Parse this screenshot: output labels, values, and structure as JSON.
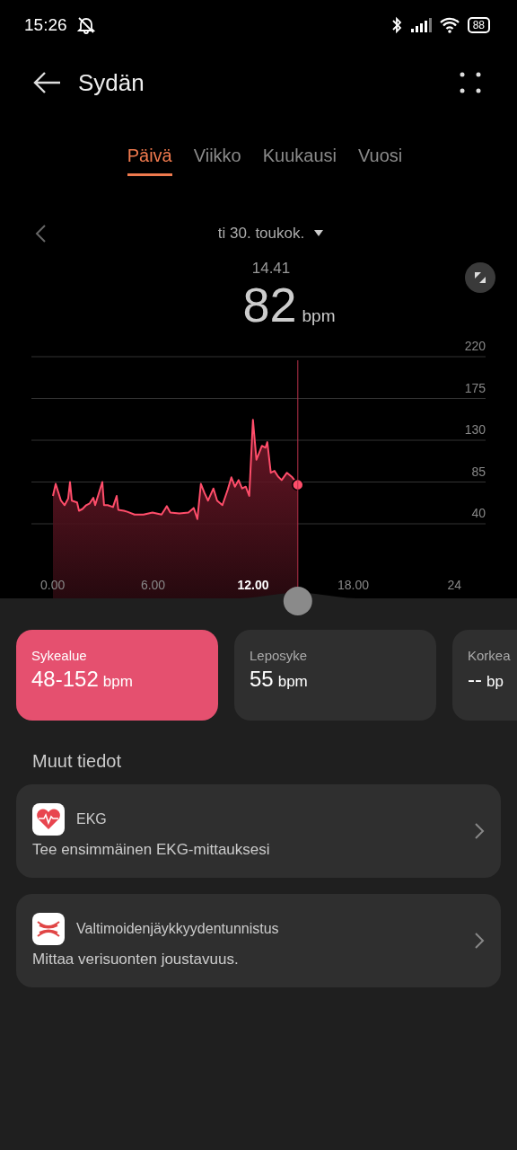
{
  "status_bar": {
    "time": "15:26",
    "battery": "88"
  },
  "header": {
    "title": "Sydän"
  },
  "tabs": [
    {
      "label": "Päivä",
      "selected": true
    },
    {
      "label": "Viikko",
      "selected": false
    },
    {
      "label": "Kuukausi",
      "selected": false
    },
    {
      "label": "Vuosi",
      "selected": false
    }
  ],
  "date_nav": {
    "date": "ti 30. toukok."
  },
  "reading": {
    "time": "14.41",
    "value": "82",
    "unit": "bpm"
  },
  "chart_data": {
    "type": "area",
    "x": [
      0,
      0.16,
      0.48,
      0.7,
      0.91,
      1.02,
      1.13,
      1.45,
      1.56,
      1.77,
      1.99,
      2.2,
      2.42,
      2.53,
      2.96,
      3.06,
      3.28,
      3.6,
      3.82,
      3.92,
      4.25,
      4.46,
      4.89,
      5.43,
      5.97,
      6.51,
      6.83,
      7.04,
      7.58,
      8.12,
      8.44,
      8.66,
      8.87,
      9.09,
      9.3,
      9.62,
      9.84,
      10.16,
      10.48,
      10.7,
      10.91,
      11.13,
      11.34,
      11.56,
      11.77,
      11.99,
      12.2,
      12.42,
      12.53,
      12.74,
      12.85,
      13.06,
      13.28,
      13.49,
      13.71,
      14.03,
      14.35,
      14.57,
      14.68
    ],
    "series": [
      {
        "color": "#ff4d6a",
        "values": [
          70,
          83,
          65,
          60,
          67,
          85,
          65,
          63,
          54,
          56,
          60,
          62,
          68,
          60,
          85,
          60,
          60,
          58,
          70,
          55,
          54,
          53,
          50,
          50,
          52,
          50,
          59,
          52,
          51,
          52,
          57,
          45,
          83,
          73,
          65,
          78,
          65,
          60,
          77,
          90,
          80,
          87,
          78,
          80,
          70,
          152,
          109,
          119,
          124,
          122,
          128,
          95,
          97,
          91,
          87,
          95,
          90,
          85,
          82
        ]
      }
    ],
    "xlim": [
      0,
      24
    ],
    "ylim": [
      40,
      220
    ],
    "xticks": [
      {
        "value": 0,
        "label": "0.00"
      },
      {
        "value": 6,
        "label": "6.00"
      },
      {
        "value": 12,
        "label": "12.00"
      },
      {
        "value": 18,
        "label": "18.00"
      },
      {
        "value": 24,
        "label": "24"
      }
    ],
    "yticks": [
      40,
      85,
      130,
      175,
      220
    ],
    "grid": true,
    "ref_lines": [
      {
        "axis": "x",
        "value": 14.68
      }
    ]
  },
  "summary_cards": [
    {
      "label": "Sykealue",
      "value": "48-152",
      "unit": "bpm",
      "selected": true
    },
    {
      "label": "Leposyke",
      "value": "55",
      "unit": "bpm",
      "selected": false
    },
    {
      "label": "Korkea",
      "value": "--",
      "unit": "bp",
      "selected": false
    }
  ],
  "other_info": {
    "title": "Muut tiedot",
    "items": [
      {
        "kind": "ekg",
        "title": "EKG",
        "subtitle": "Tee ensimmäinen EKG-mittauksesi"
      },
      {
        "kind": "artery",
        "title": "Valtimoidenjäykkyydentunnistus",
        "subtitle": "Mittaa verisuonten joustavuus."
      }
    ]
  }
}
